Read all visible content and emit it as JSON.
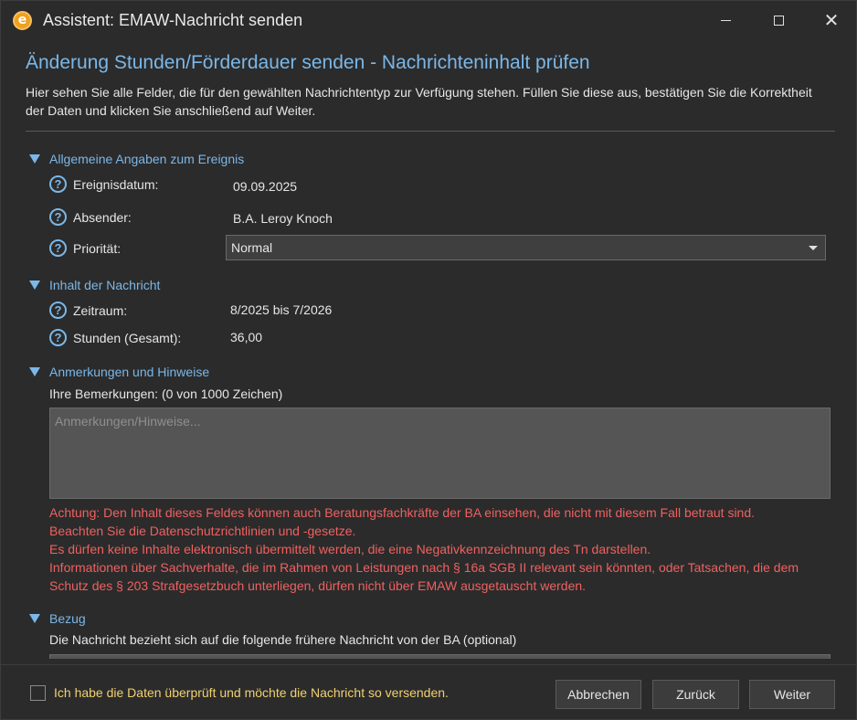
{
  "window": {
    "title": "Assistent: EMAW-Nachricht senden",
    "app_icon_letter": "e"
  },
  "header": {
    "heading": "Änderung Stunden/Förderdauer senden - Nachrichteninhalt prüfen",
    "intro": "Hier sehen Sie alle Felder, die für den gewählten Nachrichtentyp zur Verfügung stehen. Füllen Sie diese aus, bestätigen Sie die Korrektheit der Daten und klicken Sie anschließend auf Weiter."
  },
  "sections": {
    "general": {
      "label": "Allgemeine Angaben zum Ereignis",
      "date_label": "Ereignisdatum:",
      "date_value": "09.09.2025",
      "sender_label": "Absender:",
      "sender_value": "B.A. Leroy Knoch",
      "priority_label": "Priorität:",
      "priority_value": "Normal"
    },
    "content": {
      "label": "Inhalt der Nachricht",
      "period_label": "Zeitraum:",
      "period_value": "8/2025 bis 7/2026",
      "hours_label": "Stunden (Gesamt):",
      "hours_value": "36,00"
    },
    "remarks": {
      "label": "Anmerkungen und Hinweise",
      "field_label": "Ihre Bemerkungen: (0 von 1000 Zeichen)",
      "placeholder": "Anmerkungen/Hinweise...",
      "warning_lines": [
        "Achtung: Den Inhalt dieses Feldes können auch Beratungsfachkräfte der BA einsehen, die nicht mit diesem Fall betraut sind.",
        "Beachten Sie die Datenschutzrichtlinien und -gesetze.",
        "Es dürfen keine Inhalte elektronisch übermittelt werden, die eine Negativkennzeichnung des Tn darstellen.",
        "Informationen über Sachverhalte, die im Rahmen von Leistungen nach § 16a SGB II relevant sein könnten, oder Tatsachen, die dem Schutz des § 203 Strafgesetzbuch unterliegen, dürfen nicht über EMAW ausgetauscht werden."
      ]
    },
    "reference": {
      "label": "Bezug",
      "text": "Die Nachricht bezieht sich auf die folgende frühere Nachricht von der BA (optional)"
    }
  },
  "footer": {
    "confirm_label": "Ich habe die Daten überprüft und möchte die Nachricht so versenden.",
    "cancel_label": "Abbrechen",
    "back_label": "Zurück",
    "next_label": "Weiter"
  },
  "colors": {
    "accent": "#7bb7e8",
    "warning": "#f06060",
    "confirm_text": "#f0d070",
    "background": "#2b2b2b"
  },
  "icons": [
    "app-logo-icon",
    "minimize-icon",
    "maximize-icon",
    "close-icon",
    "expand-triangle-icon",
    "help-icon",
    "dropdown-arrow-icon"
  ]
}
